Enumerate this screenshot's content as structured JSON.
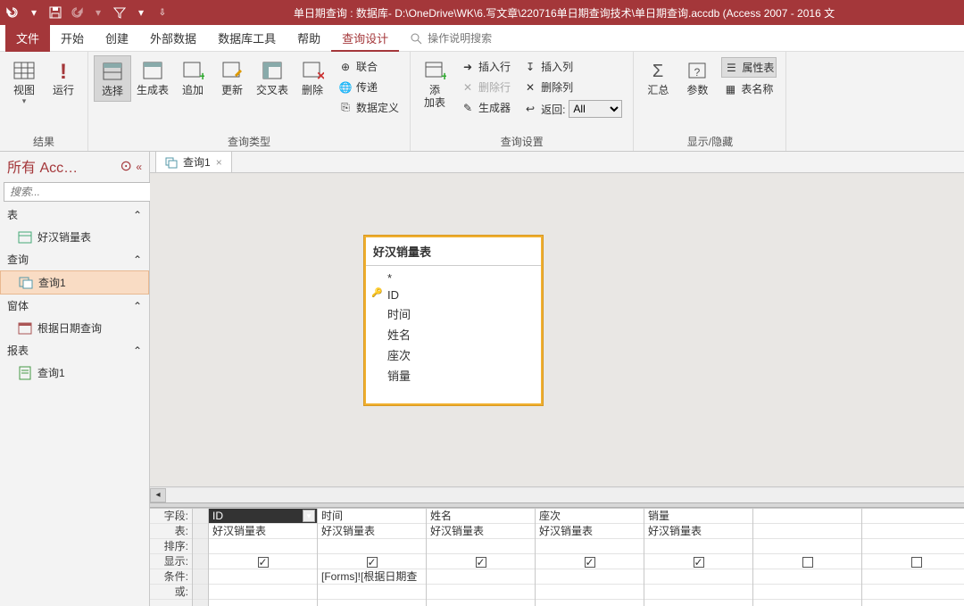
{
  "titlebar": {
    "title": "单日期查询 : 数据库- D:\\OneDrive\\WK\\6.写文章\\220716单日期查询技术\\单日期查询.accdb (Access 2007 - 2016 文"
  },
  "menu": {
    "file": "文件",
    "items": [
      "开始",
      "创建",
      "外部数据",
      "数据库工具",
      "帮助",
      "查询设计"
    ],
    "active": "查询设计",
    "search_hint": "操作说明搜索"
  },
  "ribbon": {
    "g1": {
      "label": "结果",
      "view": "视图",
      "run": "运行"
    },
    "g2": {
      "label": "查询类型",
      "select": "选择",
      "maketable": "生成表",
      "append": "追加",
      "update": "更新",
      "crosstab": "交叉表",
      "delete": "删除",
      "union": "联合",
      "passthru": "传递",
      "datadef": "数据定义"
    },
    "g3": {
      "label": "查询设置",
      "addtable": "添\n加表",
      "insrow": "插入行",
      "delrow": "删除行",
      "builder": "生成器",
      "inscol": "插入列",
      "delcol": "删除列",
      "return": "返回:",
      "return_val": "All"
    },
    "g4": {
      "label": "显示/隐藏",
      "totals": "汇总",
      "params": "参数",
      "propsheet": "属性表",
      "tablenames": "表名称"
    }
  },
  "nav": {
    "title": "所有 Acc…",
    "search_ph": "搜索...",
    "sections": {
      "tables": "表",
      "queries": "查询",
      "forms": "窗体",
      "reports": "报表"
    },
    "table1": "好汉销量表",
    "query1": "查询1",
    "form1": "根据日期查询",
    "report1": "查询1"
  },
  "tab": {
    "name": "查询1"
  },
  "tablebox": {
    "title": "好汉销量表",
    "fields": [
      "*",
      "ID",
      "时间",
      "姓名",
      "座次",
      "销量"
    ]
  },
  "grid": {
    "labels": [
      "字段:",
      "表:",
      "排序:",
      "显示:",
      "条件:",
      "或:"
    ],
    "cols": [
      {
        "field": "ID",
        "table": "好汉销量表",
        "show": true,
        "cond": "",
        "active": true
      },
      {
        "field": "时间",
        "table": "好汉销量表",
        "show": true,
        "cond": "[Forms]![根据日期查"
      },
      {
        "field": "姓名",
        "table": "好汉销量表",
        "show": true,
        "cond": ""
      },
      {
        "field": "座次",
        "table": "好汉销量表",
        "show": true,
        "cond": ""
      },
      {
        "field": "销量",
        "table": "好汉销量表",
        "show": true,
        "cond": ""
      },
      {
        "field": "",
        "table": "",
        "show": false,
        "cond": ""
      },
      {
        "field": "",
        "table": "",
        "show": false,
        "cond": ""
      }
    ]
  }
}
